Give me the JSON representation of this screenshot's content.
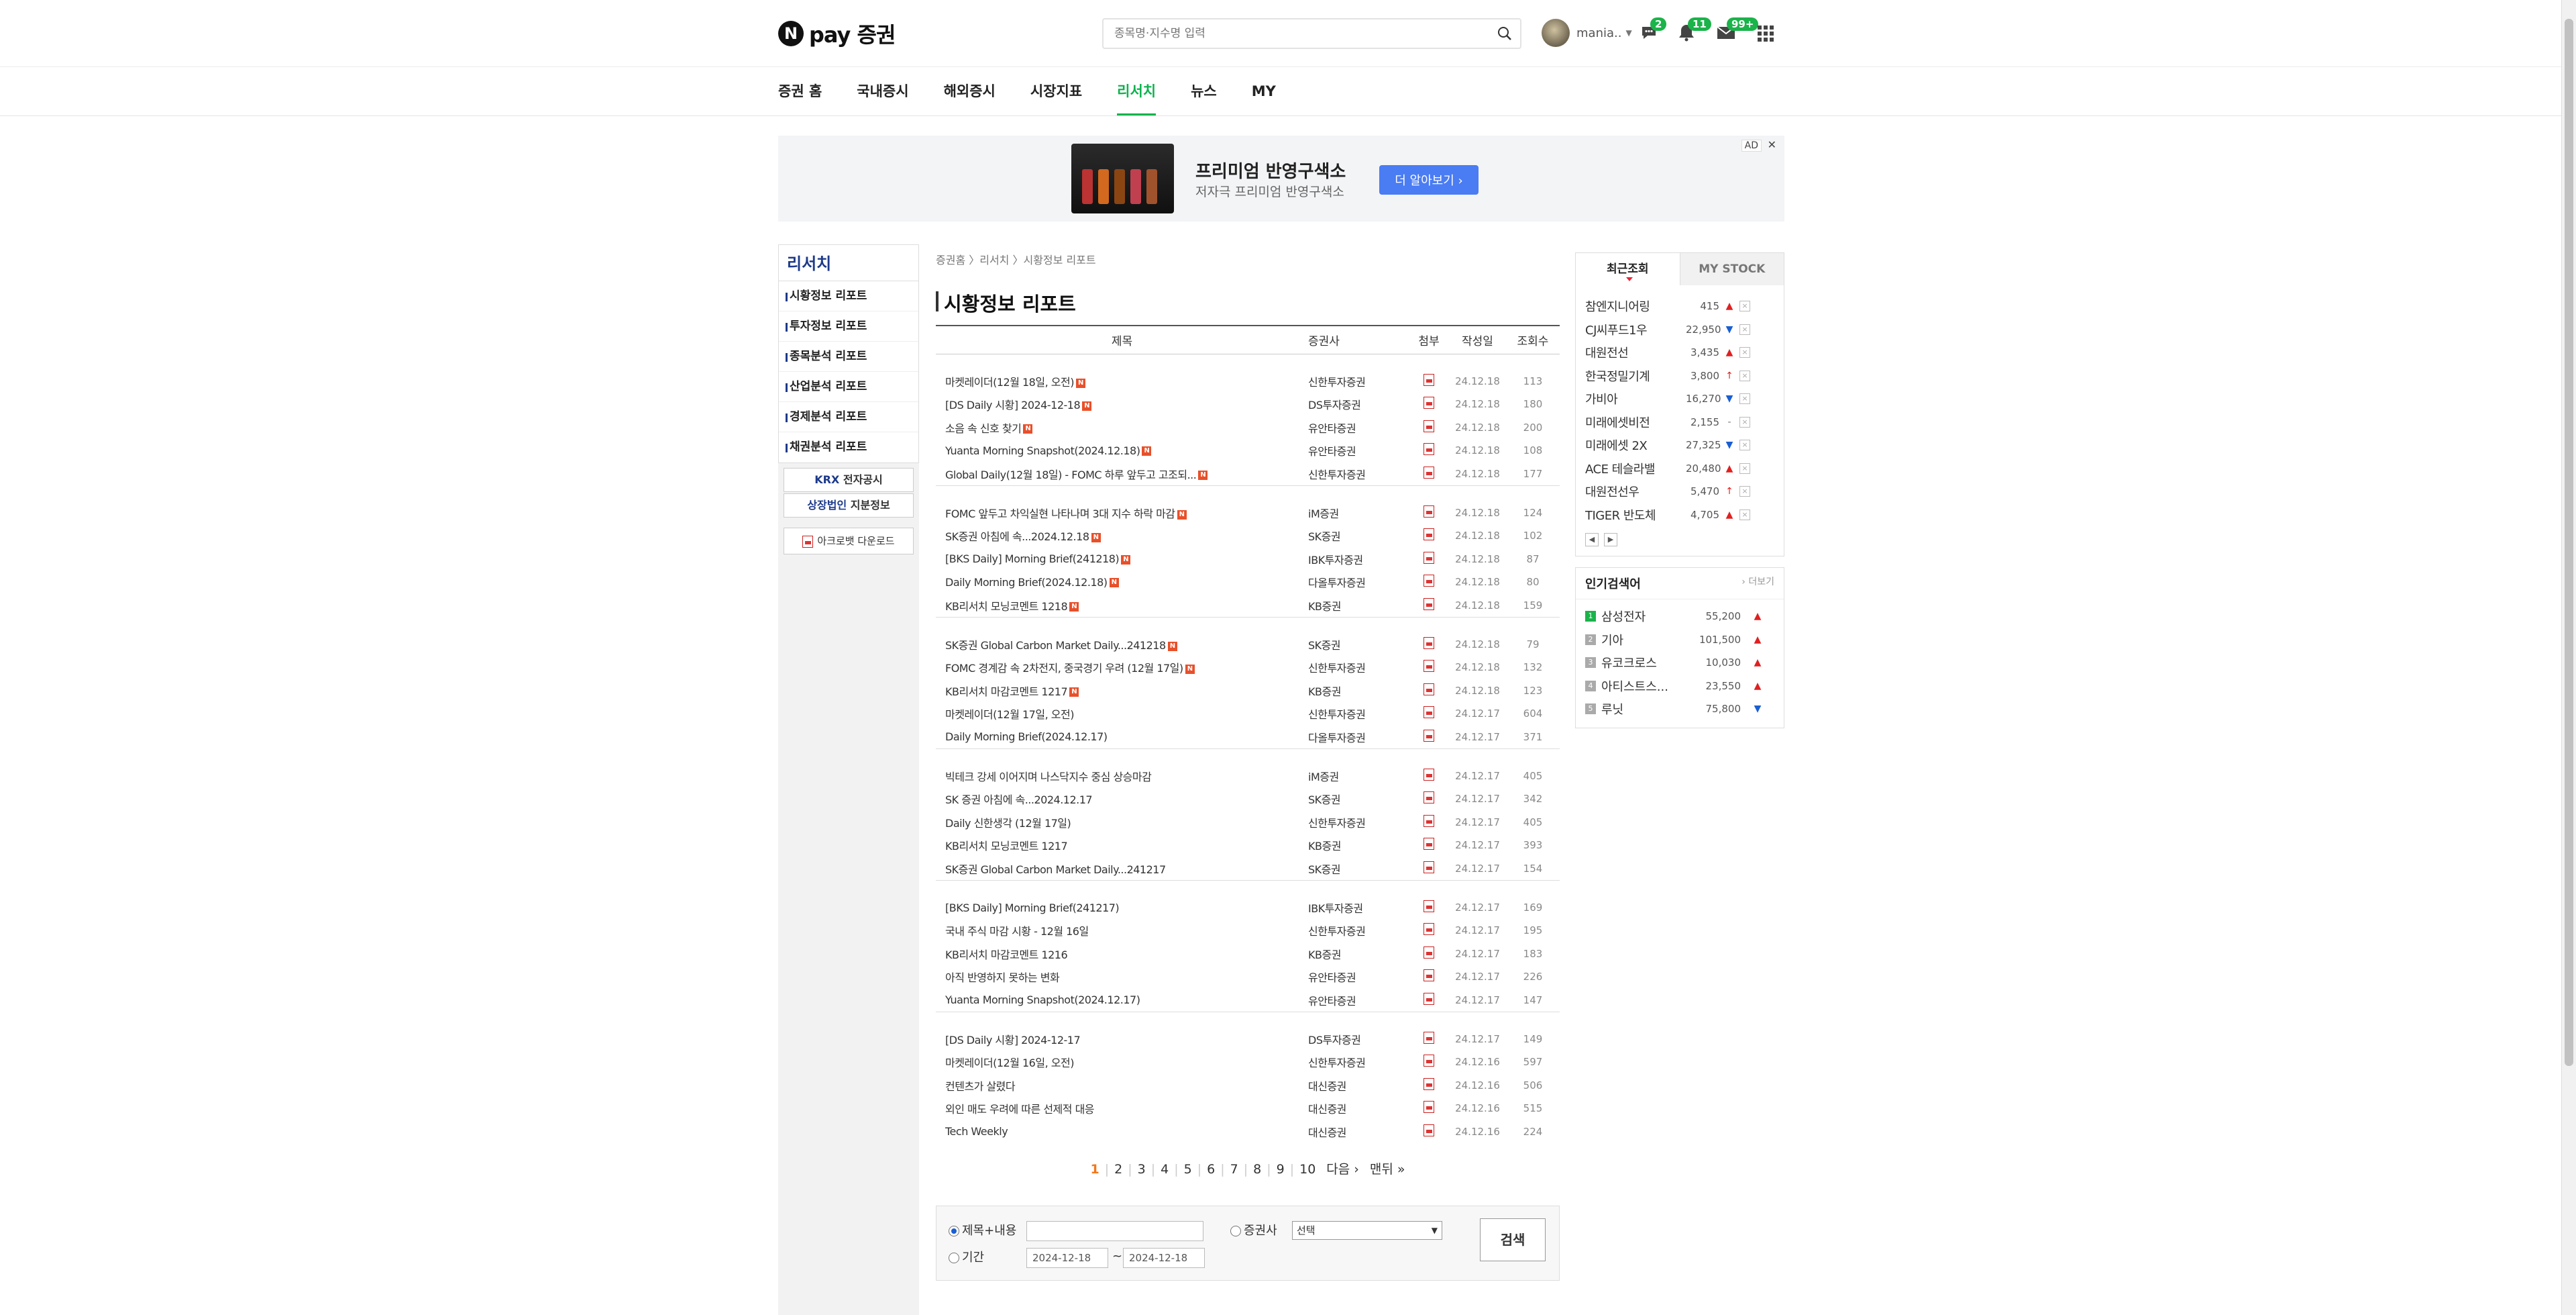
{
  "header": {
    "logo_badge": "N",
    "logo_text": "pay 증권",
    "search_placeholder": "종목명·지수명 입력",
    "user_name": "mania..",
    "notif_counts": [
      "2",
      "11",
      "99+"
    ]
  },
  "nav": [
    "증권 홈",
    "국내증시",
    "해외증시",
    "시장지표",
    "리서치",
    "뉴스",
    "MY"
  ],
  "nav_active": "리서치",
  "ad": {
    "title": "프리미엄 반영구색소",
    "subtitle": "저자극 프리미엄 반영구색소",
    "button": "더 알아보기 ›",
    "tag": "AD",
    "close": "✕"
  },
  "left": {
    "title": "리서치",
    "items": [
      "시황정보 리포트",
      "투자정보 리포트",
      "종목분석 리포트",
      "산업분석 리포트",
      "경제분석 리포트",
      "채권분석 리포트"
    ],
    "krx_a": "KRX",
    "krx_b": " 전자공시",
    "listed_a": "상장법인",
    "listed_b": " 지분정보",
    "acrobat": "아크로뱃 다운로드"
  },
  "breadcrumb": "증권홈 〉리서치 〉시황정보 리포트",
  "page_title": "시황정보 리포트",
  "table": {
    "headers": [
      "제목",
      "증권사",
      "첨부",
      "작성일",
      "조회수"
    ],
    "rows": [
      {
        "t": "마켓레이더(12월 18일, 오전)",
        "n": true,
        "f": "신한투자증권",
        "d": "24.12.18",
        "v": "113"
      },
      {
        "t": "[DS Daily 시황] 2024-12-18",
        "n": true,
        "f": "DS투자증권",
        "d": "24.12.18",
        "v": "180"
      },
      {
        "t": "소음 속 신호 찾기",
        "n": true,
        "f": "유안타증권",
        "d": "24.12.18",
        "v": "200"
      },
      {
        "t": "Yuanta Morning Snapshot(2024.12.18)",
        "n": true,
        "f": "유안타증권",
        "d": "24.12.18",
        "v": "108"
      },
      {
        "t": "Global Daily(12월 18일) - FOMC 하루 앞두고 고조되...",
        "n": true,
        "f": "신한투자증권",
        "d": "24.12.18",
        "v": "177"
      },
      {
        "t": "FOMC 앞두고 차익실현 나타나며 3대 지수 하락 마감",
        "n": true,
        "f": "iM증권",
        "d": "24.12.18",
        "v": "124"
      },
      {
        "t": "SK증권 아침에 속...2024.12.18",
        "n": true,
        "f": "SK증권",
        "d": "24.12.18",
        "v": "102"
      },
      {
        "t": "[BKS Daily] Morning Brief(241218)",
        "n": true,
        "f": "IBK투자증권",
        "d": "24.12.18",
        "v": "87"
      },
      {
        "t": "Daily Morning Brief(2024.12.18)",
        "n": true,
        "f": "다올투자증권",
        "d": "24.12.18",
        "v": "80"
      },
      {
        "t": "KB리서치 모닝코멘트 1218",
        "n": true,
        "f": "KB증권",
        "d": "24.12.18",
        "v": "159"
      },
      {
        "t": "SK증권 Global Carbon Market Daily...241218",
        "n": true,
        "f": "SK증권",
        "d": "24.12.18",
        "v": "79"
      },
      {
        "t": "FOMC 경계감 속 2차전지, 중국경기 우려 (12월 17일)",
        "n": true,
        "f": "신한투자증권",
        "d": "24.12.18",
        "v": "132"
      },
      {
        "t": "KB리서치 마감코멘트 1217",
        "n": true,
        "f": "KB증권",
        "d": "24.12.18",
        "v": "123"
      },
      {
        "t": "마켓레이더(12월 17일, 오전)",
        "n": false,
        "f": "신한투자증권",
        "d": "24.12.17",
        "v": "604"
      },
      {
        "t": "Daily Morning Brief(2024.12.17)",
        "n": false,
        "f": "다올투자증권",
        "d": "24.12.17",
        "v": "371"
      },
      {
        "t": "빅테크 강세 이어지며 나스닥지수 중심 상승마감",
        "n": false,
        "f": "iM증권",
        "d": "24.12.17",
        "v": "405"
      },
      {
        "t": "SK 증권 아침에 속...2024.12.17",
        "n": false,
        "f": "SK증권",
        "d": "24.12.17",
        "v": "342"
      },
      {
        "t": "Daily 신한생각 (12월 17일)",
        "n": false,
        "f": "신한투자증권",
        "d": "24.12.17",
        "v": "405"
      },
      {
        "t": "KB리서치 모닝코멘트 1217",
        "n": false,
        "f": "KB증권",
        "d": "24.12.17",
        "v": "393"
      },
      {
        "t": "SK증권 Global Carbon Market Daily...241217",
        "n": false,
        "f": "SK증권",
        "d": "24.12.17",
        "v": "154"
      },
      {
        "t": "[BKS Daily] Morning Brief(241217)",
        "n": false,
        "f": "IBK투자증권",
        "d": "24.12.17",
        "v": "169"
      },
      {
        "t": "국내 주식 마감 시황 - 12월 16일",
        "n": false,
        "f": "신한투자증권",
        "d": "24.12.17",
        "v": "195"
      },
      {
        "t": "KB리서치 마감코멘트 1216",
        "n": false,
        "f": "KB증권",
        "d": "24.12.17",
        "v": "183"
      },
      {
        "t": "아직 반영하지 못하는 변화",
        "n": false,
        "f": "유안타증권",
        "d": "24.12.17",
        "v": "226"
      },
      {
        "t": "Yuanta Morning Snapshot(2024.12.17)",
        "n": false,
        "f": "유안타증권",
        "d": "24.12.17",
        "v": "147"
      },
      {
        "t": "[DS Daily 시황] 2024-12-17",
        "n": false,
        "f": "DS투자증권",
        "d": "24.12.17",
        "v": "149"
      },
      {
        "t": "마켓레이더(12월 16일, 오전)",
        "n": false,
        "f": "신한투자증권",
        "d": "24.12.16",
        "v": "597"
      },
      {
        "t": "컨텐츠가 살렸다",
        "n": false,
        "f": "대신증권",
        "d": "24.12.16",
        "v": "506"
      },
      {
        "t": "외인 매도 우려에 따른 선제적 대응",
        "n": false,
        "f": "대신증권",
        "d": "24.12.16",
        "v": "515"
      },
      {
        "t": "Tech Weekly",
        "n": false,
        "f": "대신증권",
        "d": "24.12.16",
        "v": "224"
      }
    ]
  },
  "paging": [
    "1",
    "2",
    "3",
    "4",
    "5",
    "6",
    "7",
    "8",
    "9",
    "10",
    "다음 ›",
    "맨뒤 »"
  ],
  "search_form": {
    "opt_title": "제목+내용",
    "opt_firm": "증권사",
    "opt_period": "기간",
    "firm_select": "선택",
    "date_from": "2024-12-18",
    "date_to": "2024-12-18",
    "tilde": "~",
    "button": "검색"
  },
  "recent": {
    "tab1": "최근조회",
    "tab2": "MY STOCK",
    "items": [
      {
        "name": "참엔지니어링",
        "price": "415",
        "dir": "up"
      },
      {
        "name": "CJ씨푸드1우",
        "price": "22,950",
        "dir": "dn"
      },
      {
        "name": "대원전선",
        "price": "3,435",
        "dir": "up"
      },
      {
        "name": "한국정밀기계",
        "price": "3,800",
        "dir": "up2"
      },
      {
        "name": "가비아",
        "price": "16,270",
        "dir": "dn"
      },
      {
        "name": "미래에셋비전",
        "price": "2,155",
        "dir": "flat"
      },
      {
        "name": "미래에셋 2X",
        "price": "27,325",
        "dir": "dn"
      },
      {
        "name": "ACE 테슬라밸",
        "price": "20,480",
        "dir": "up"
      },
      {
        "name": "대원전선우",
        "price": "5,470",
        "dir": "up2"
      },
      {
        "name": "TIGER 반도체",
        "price": "4,705",
        "dir": "up"
      }
    ]
  },
  "popular": {
    "title": "인기검색어",
    "more": "› 더보기",
    "items": [
      {
        "rank": "1",
        "name": "삼성전자",
        "price": "55,200",
        "dir": "up"
      },
      {
        "rank": "2",
        "name": "기아",
        "price": "101,500",
        "dir": "up"
      },
      {
        "rank": "3",
        "name": "유코크로스",
        "price": "10,030",
        "dir": "up"
      },
      {
        "rank": "4",
        "name": "아티스트스...",
        "price": "23,550",
        "dir": "up"
      },
      {
        "rank": "5",
        "name": "루닛",
        "price": "75,800",
        "dir": "dn"
      }
    ]
  }
}
